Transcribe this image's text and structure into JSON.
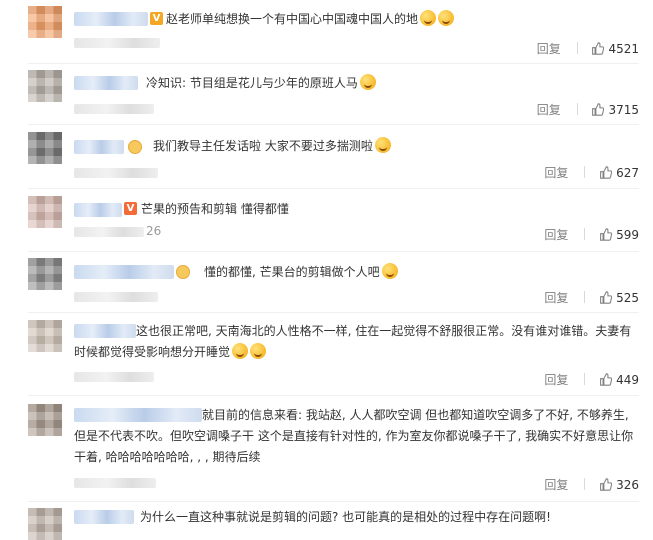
{
  "comments": [
    {
      "text": "赵老师单纯想换一个有中国心中国魂中国人的地",
      "reply": "回复",
      "likes": "4521",
      "emoji": "cat-face-emoji x2",
      "badge": "V"
    },
    {
      "text": "冷知识: 节目组是花儿与少年的原班人马",
      "reply": "回复",
      "likes": "3715",
      "emoji": "smile-emoji"
    },
    {
      "text": "我们教导主任发话啦 大家不要过多揣测啦",
      "reply": "回复",
      "likes": "627",
      "emoji": "praying-hands-emoji"
    },
    {
      "text": "芒果的预告和剪辑 懂得都懂",
      "reply": "回复",
      "likes": "599",
      "sub": "26",
      "badge": "V"
    },
    {
      "text": "懂的都懂, 芒果台的剪辑做个人吧",
      "reply": "回复",
      "likes": "525",
      "emoji": "cool-emoji"
    },
    {
      "line1": "这也很正常吧, 天南海北的人性格不一样, 住在一起觉得不舒服很正常。没有谁对谁错。夫妻有",
      "line2": "时候都觉得受影响想分开睡觉",
      "reply": "回复",
      "likes": "449",
      "emoji": "laughing-emoji x2"
    },
    {
      "line1": "就目前的信息来看: 我站赵, 人人都吹空调 但也都知道吹空调多了不好, 不够养生,",
      "line2": "但是不代表不吹。但吹空调嗓子干 这个是直接有针对性的, 作为室友你都说嗓子干了, 我确实不好意思让你",
      "line3": "干着, 哈哈哈哈哈哈哈, , , 期待后续",
      "reply": "回复",
      "likes": "326"
    },
    {
      "text": "为什么一直这种事就说是剪辑的问题? 也可能真的是相处的过程中存在问题啊!"
    }
  ],
  "colors": {
    "badge": "#f5a623",
    "link": "#eb7350",
    "muted": "#808080"
  }
}
